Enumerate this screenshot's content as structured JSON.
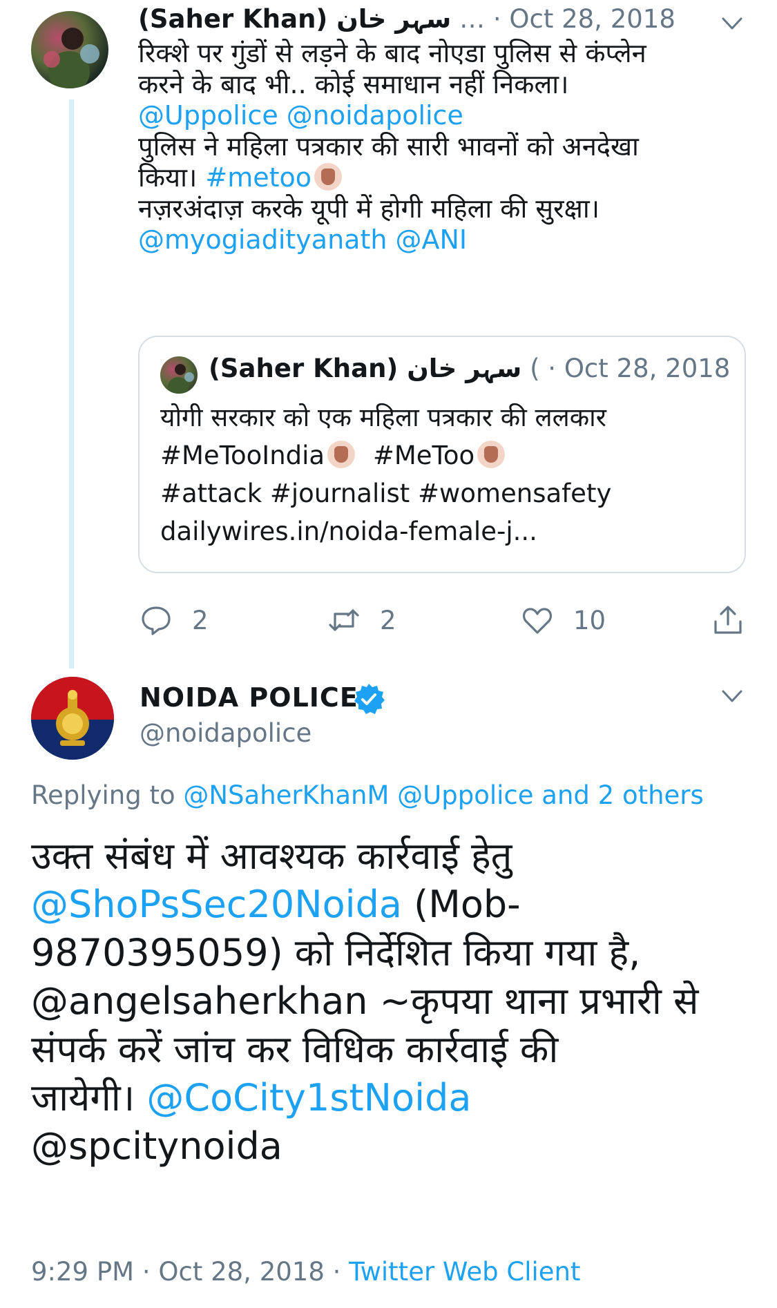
{
  "tweet1": {
    "author_name": "(Saher Khan) سہر خان",
    "ellipsis": "…",
    "date": "· Oct 28, 2018",
    "lines": [
      "रिक्शे पर गुंडों से लड़ने के बाद नोएडा पुलिस से कंप्लेन",
      "करने के बाद भी.. कोई समाधान नहीं निकला।",
      "@Uppolice @noidapolice",
      " पुलिस ने महिला पत्रकार की सारी भावनों को अनदेखा",
      "किया। ",
      "#metoo",
      " नज़रअंदाज़ करके यूपी में होगी महिला की सुरक्षा।",
      "@myogiadityanath @ANI"
    ],
    "quoted": {
      "author_name": "(Saher Khan) سہر خان",
      "trail": "( ·",
      "date": "Oct 28, 2018",
      "lines": [
        "योगी सरकार को एक महिला पत्रकार की ललकार",
        "#MeTooIndia",
        "#MeToo",
        "#attack #journalist #womensafety",
        "dailywires.in/noida-female-j..."
      ]
    },
    "actions": {
      "replies": "2",
      "retweets": "2",
      "likes": "10"
    }
  },
  "tweet2": {
    "author_name": "NOIDA POLICE",
    "handle": "@noidapolice",
    "replying_prefix": "Replying to",
    "replying_targets": "@NSaherKhanM @Uppolice and 2 others",
    "body": {
      "line1": "उक्त संबंध में आवश्यक कार्रवाई हेतु",
      "mention1": "@ShoPsSec20Noida",
      "line2_rest": " (Mob-",
      "line3": "9870395059) को निर्देशित किया गया है,",
      "line4": "@angelsaherkhan ~कृपया थाना प्रभारी से",
      "line5": "संपर्क करें जांच कर विधिक कार्रवाई की",
      "line6_text": "जायेगी। ",
      "mention2": "@CoCity1stNoida",
      "mention3": "@spcitynoida"
    },
    "time": "9:29 PM · Oct 28, 2018 ·",
    "source": "Twitter Web Client"
  }
}
